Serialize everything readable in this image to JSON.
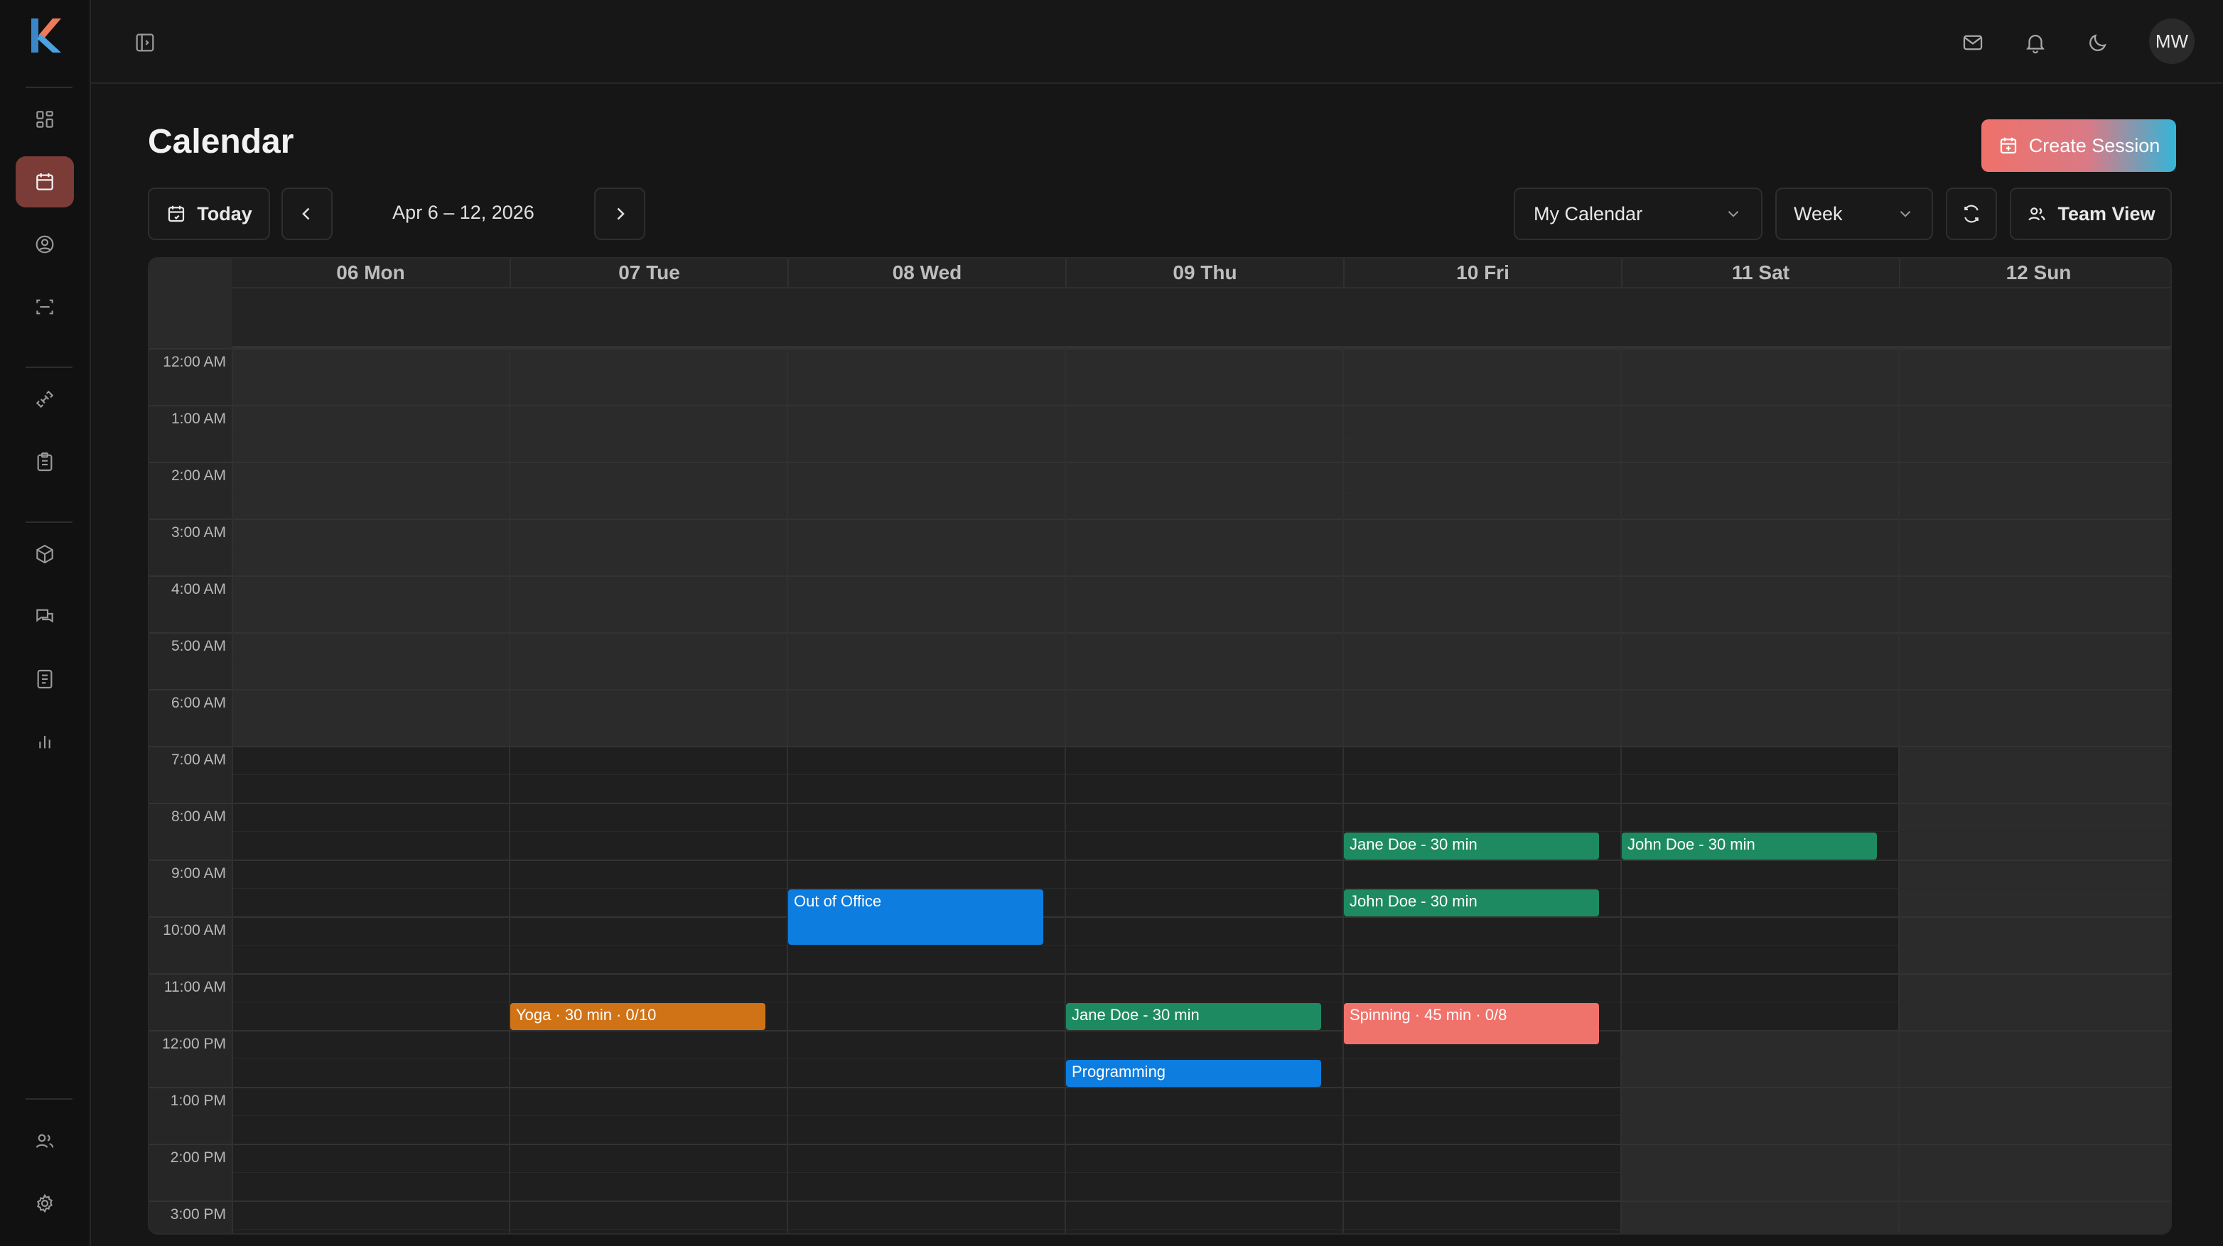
{
  "colors": {
    "accent_active": "#7b3b37",
    "event_green": "#1e8a61",
    "event_blue": "#0d7de0",
    "event_orange": "#d07316",
    "event_coral": "#ef726b"
  },
  "sidebar": {
    "logo": "K",
    "items": [
      {
        "icon": "dashboard-icon",
        "active": false
      },
      {
        "icon": "calendar-icon",
        "active": true
      },
      {
        "icon": "user-circle-icon",
        "active": false
      },
      {
        "icon": "scan-icon",
        "active": false
      },
      {
        "icon": "dumbbell-icon",
        "active": false
      },
      {
        "icon": "clipboard-icon",
        "active": false
      },
      {
        "icon": "package-icon",
        "active": false
      },
      {
        "icon": "messages-icon",
        "active": false
      },
      {
        "icon": "document-icon",
        "active": false
      },
      {
        "icon": "bar-chart-icon",
        "active": false
      },
      {
        "icon": "users-icon",
        "active": false
      },
      {
        "icon": "gear-icon",
        "active": false
      }
    ]
  },
  "topbar": {
    "toggle_icon": "sidebar-toggle-icon",
    "icons": [
      "mail-icon",
      "bell-icon",
      "moon-icon"
    ],
    "avatar": "MW"
  },
  "header": {
    "title": "Calendar",
    "create_button": "Create Session"
  },
  "controls": {
    "today": "Today",
    "date_range": "Apr 6 – 12, 2026",
    "calendar_select": "My Calendar",
    "view_select": "Week",
    "team_view": "Team View"
  },
  "calendar": {
    "days": [
      "06 Mon",
      "07 Tue",
      "08 Wed",
      "09 Thu",
      "10 Fri",
      "11 Sat",
      "12 Sun"
    ],
    "hours": [
      "12:00 AM",
      "1:00 AM",
      "2:00 AM",
      "3:00 AM",
      "4:00 AM",
      "5:00 AM",
      "6:00 AM",
      "7:00 AM",
      "8:00 AM",
      "9:00 AM",
      "10:00 AM",
      "11:00 AM",
      "12:00 PM",
      "1:00 PM",
      "2:00 PM",
      "3:00 PM"
    ],
    "events": [
      {
        "day": 4,
        "start": 8.5,
        "end": 9.0,
        "label": "Jane Doe - 30 min",
        "color": "#1e8a61"
      },
      {
        "day": 5,
        "start": 8.5,
        "end": 9.0,
        "label": "John Doe - 30 min",
        "color": "#1e8a61"
      },
      {
        "day": 2,
        "start": 9.5,
        "end": 10.5,
        "label": "Out of Office",
        "color": "#0d7de0"
      },
      {
        "day": 4,
        "start": 9.5,
        "end": 10.0,
        "label": "John Doe - 30 min",
        "color": "#1e8a61"
      },
      {
        "day": 1,
        "start": 11.5,
        "end": 12.0,
        "label": "Yoga · 30 min · 0/10",
        "color": "#d07316"
      },
      {
        "day": 3,
        "start": 11.5,
        "end": 12.0,
        "label": "Jane Doe - 30 min",
        "color": "#1e8a61"
      },
      {
        "day": 4,
        "start": 11.5,
        "end": 12.25,
        "label": "Spinning · 45 min · 0/8",
        "color": "#ef726b"
      },
      {
        "day": 3,
        "start": 12.5,
        "end": 13.0,
        "label": "Programming",
        "color": "#0d7de0"
      }
    ]
  }
}
